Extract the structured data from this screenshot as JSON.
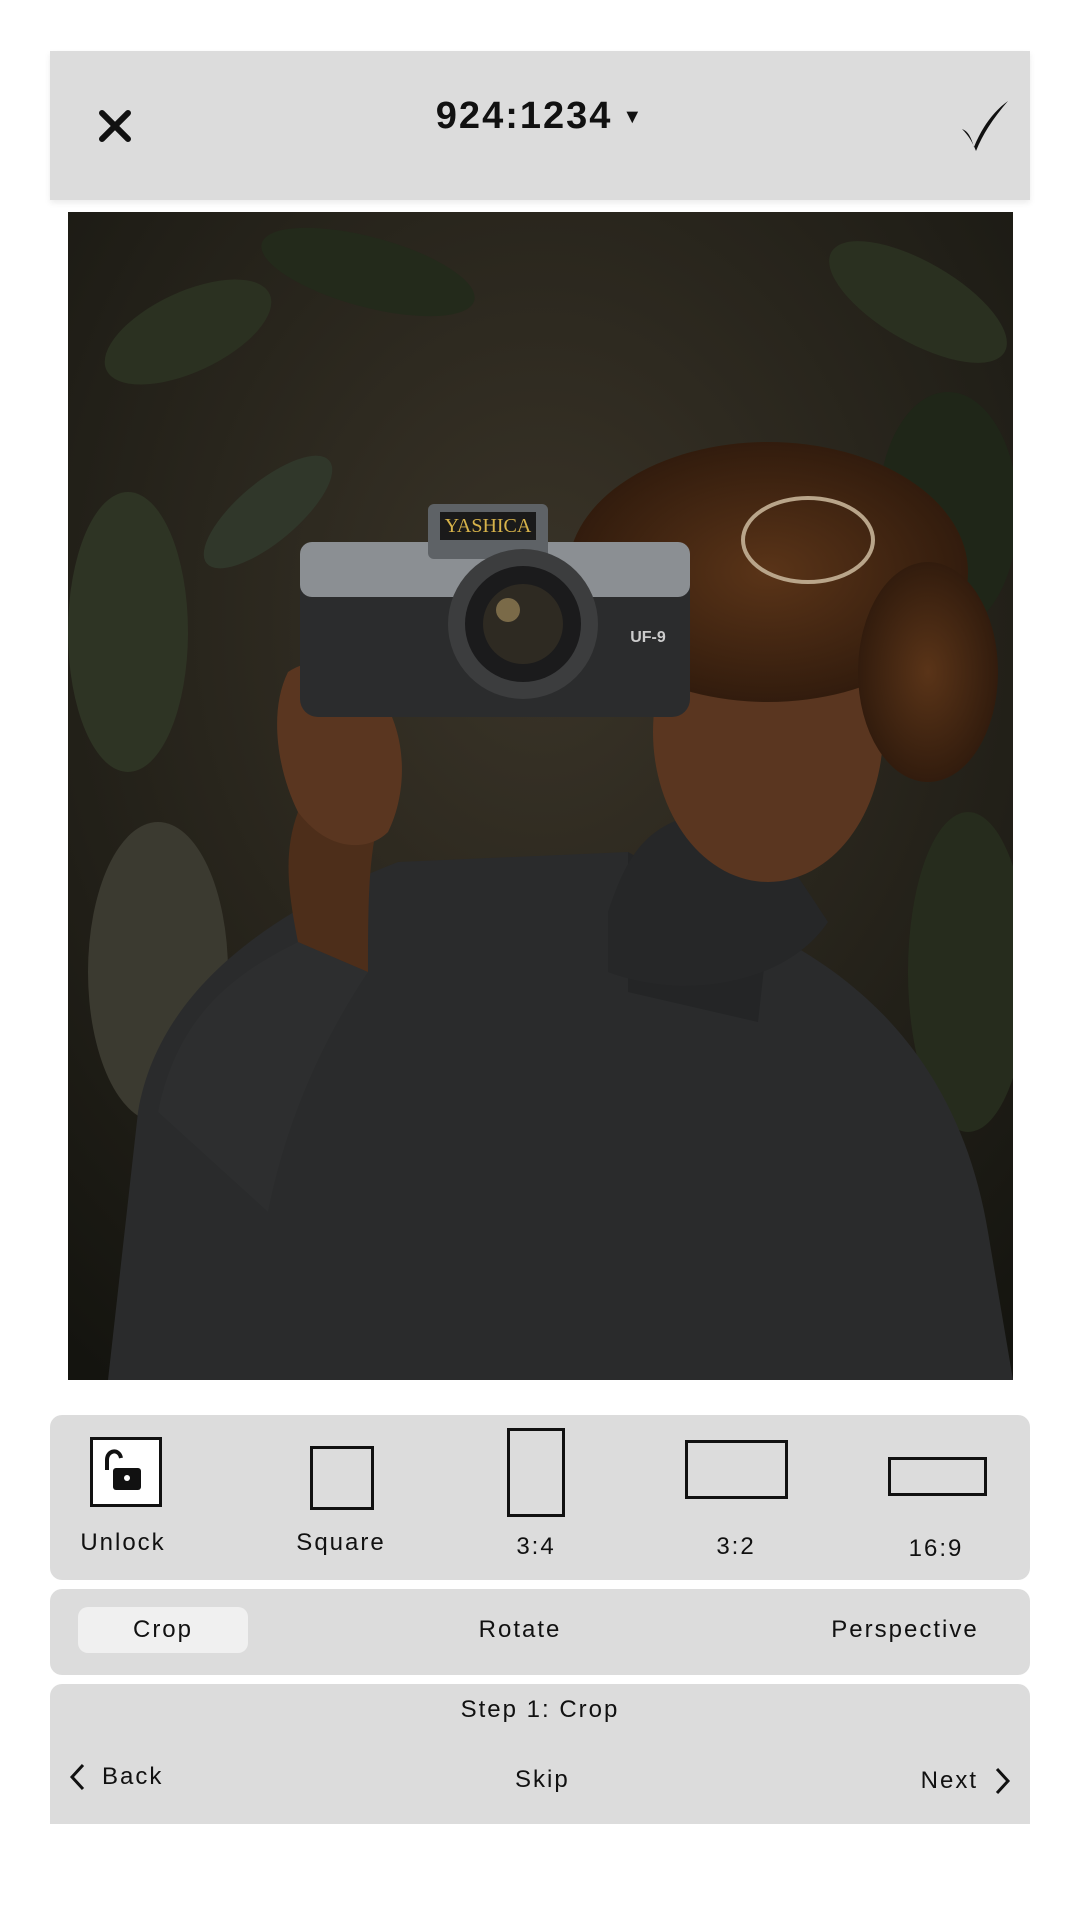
{
  "header": {
    "ratio_value": "924:1234",
    "close_icon": "close-icon",
    "confirm_icon": "checkmark-icon",
    "dropdown_icon": "caret-down-icon"
  },
  "ratios": [
    {
      "label": "Unlock",
      "icon": "unlock-icon"
    },
    {
      "label": "Square",
      "icon": "square-ratio-icon"
    },
    {
      "label": "3:4",
      "icon": "portrait-ratio-icon"
    },
    {
      "label": "3:2",
      "icon": "landscape-ratio-icon"
    },
    {
      "label": "16:9",
      "icon": "wide-ratio-icon"
    }
  ],
  "tools": {
    "crop": "Crop",
    "rotate": "Rotate",
    "perspective": "Perspective",
    "active": "Crop"
  },
  "steps": {
    "title": "Step 1: Crop",
    "back": "Back",
    "skip": "Skip",
    "next": "Next"
  },
  "photo": {
    "camera_brand": "YASHICA",
    "camera_model": "UF-9"
  },
  "colors": {
    "panel": "#dcdcdc",
    "active_tab": "#f0f0f0",
    "icon": "#111111"
  }
}
